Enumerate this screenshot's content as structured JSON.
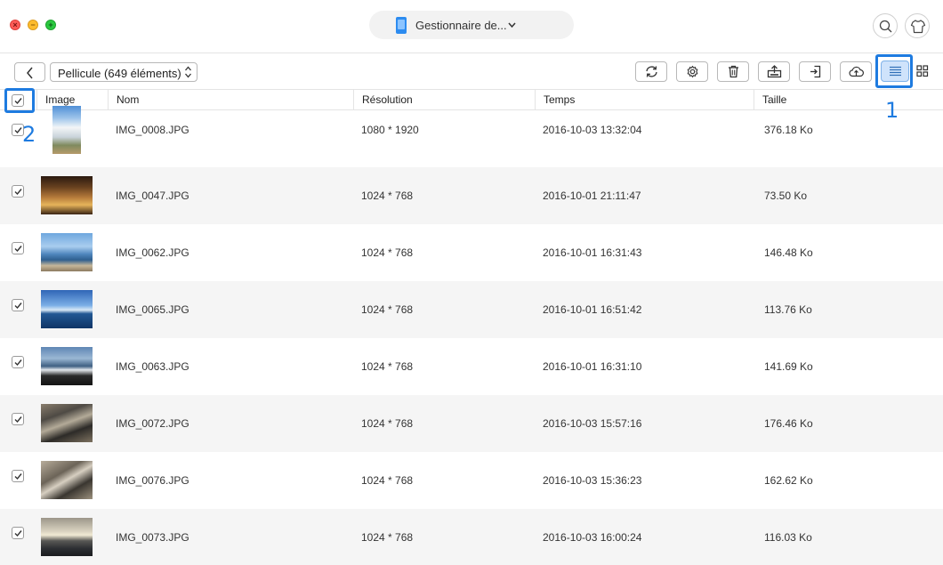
{
  "window": {
    "device_name": "Gestionnaire de...",
    "close_symbol": "×",
    "minimize_symbol": "−",
    "maximize_symbol": "+"
  },
  "toolbar": {
    "album": "Pellicule (649 éléments)"
  },
  "table": {
    "headers": {
      "image": "Image",
      "name": "Nom",
      "resolution": "Résolution",
      "time": "Temps",
      "size": "Taille"
    },
    "select_all_checked": true,
    "rows": [
      {
        "name": "IMG_0008.JPG",
        "resolution": "1080 * 1920",
        "time": "2016-10-03 13:32:04",
        "size": "376.18 Ko",
        "checked": true,
        "thumb": "sky-clouds-palm"
      },
      {
        "name": "IMG_0047.JPG",
        "resolution": "1024 * 768",
        "time": "2016-10-01 21:11:47",
        "size": "73.50 Ko",
        "checked": true,
        "thumb": "warm-interior"
      },
      {
        "name": "IMG_0062.JPG",
        "resolution": "1024 * 768",
        "time": "2016-10-01 16:31:43",
        "size": "146.48 Ko",
        "checked": true,
        "thumb": "beach-people"
      },
      {
        "name": "IMG_0065.JPG",
        "resolution": "1024 * 768",
        "time": "2016-10-01 16:51:42",
        "size": "113.76 Ko",
        "checked": true,
        "thumb": "blue-sea-sky"
      },
      {
        "name": "IMG_0063.JPG",
        "resolution": "1024 * 768",
        "time": "2016-10-01 16:31:10",
        "size": "141.69 Ko",
        "checked": true,
        "thumb": "sea-waves-dark-sand"
      },
      {
        "name": "IMG_0072.JPG",
        "resolution": "1024 * 768",
        "time": "2016-10-03 15:57:16",
        "size": "176.46 Ko",
        "checked": true,
        "thumb": "rocks-shore"
      },
      {
        "name": "IMG_0076.JPG",
        "resolution": "1024 * 768",
        "time": "2016-10-03 15:36:23",
        "size": "162.62 Ko",
        "checked": true,
        "thumb": "pebbles-close"
      },
      {
        "name": "IMG_0073.JPG",
        "resolution": "1024 * 768",
        "time": "2016-10-03 16:00:24",
        "size": "116.03 Ko",
        "checked": true,
        "thumb": "sunset-coast"
      }
    ]
  },
  "annotations": {
    "callout_1": "1",
    "callout_2": "2"
  },
  "colors": {
    "highlight": "#1e7be0",
    "row_alt": "#f5f5f5",
    "list_view_active": "#cfe3fb"
  }
}
